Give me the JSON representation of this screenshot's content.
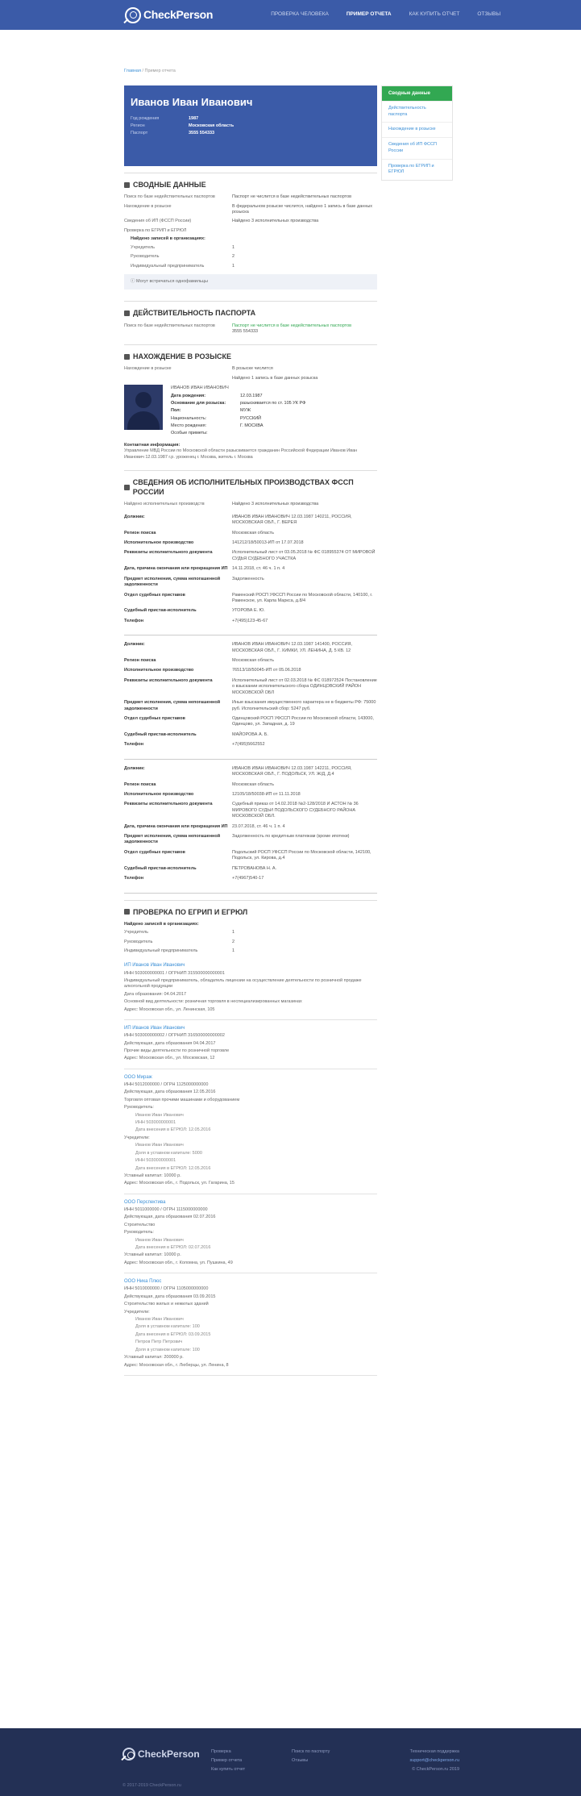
{
  "header": {
    "logo": "CheckPerson",
    "nav": [
      "ПРОВЕРКА ЧЕЛОВЕКА",
      "ПРИМЕР ОТЧЕТА",
      "КАК КУПИТЬ ОТЧЕТ",
      "ОТЗЫВЫ"
    ]
  },
  "breadcrumb": {
    "home": "Главная",
    "current": "/ Пример отчета"
  },
  "card": {
    "name": "Иванов Иван Иванович",
    "birth_k": "Год рождения",
    "birth_v": "1987",
    "region_k": "Регион",
    "region_v": "Московская область",
    "passport_k": "Паспорт",
    "passport_v": "3555 554333"
  },
  "sidebar": {
    "title": "Сводные данные",
    "items": [
      "Действительность паспорта",
      "Нахождение в розыске",
      "Сведения об ИП ФССП России",
      "Проверка по ЕГРИП и ЕГРЮЛ"
    ]
  },
  "s1": {
    "title": "Сводные данные",
    "r1k": "Поиск по базе недействительных паспортов",
    "r1v": "Паспорт не числится в базе недействительных паспортов",
    "r2k": "Нахождение в розыске",
    "r2v": "В федеральном розыске числится, найдено 1 запись в базе данных розыска",
    "r3k": "Сведения об ИП (ФССП России)",
    "r3v": "Найдено 3 исполнительных производства",
    "egr": "Проверка по ЕГРИП и ЕГРЮЛ",
    "found": "Найдено записей в организациях:",
    "f1k": "Учредитель",
    "f1v": "1",
    "f2k": "Руководитель",
    "f2v": "2",
    "f3k": "Индивидуальный предприниматель",
    "f3v": "1",
    "hint": "Могут встречаться однофамильцы"
  },
  "s2": {
    "title": "Действительность паспорта",
    "k": "Поиск по базе недействительных паспортов",
    "v": "Паспорт не числится в базе недействительных паспортов",
    "v2": "3555 554333"
  },
  "s3": {
    "title": "Нахождение в розыске",
    "k": "Нахождение в розыске",
    "v": "В розыске числится",
    "v2": "Найдено 1 запись в базе данных розыска",
    "pname": "ИВАНОВ ИВАН ИВАНОВИЧ",
    "d": [
      [
        "Дата рождения:",
        "12.03.1987"
      ],
      [
        "Основание для розыска:",
        "разыскивается по ст. 105 УК РФ"
      ],
      [
        "Пол:",
        "МУЖ"
      ],
      [
        "Национальность:",
        "РУССКИЙ"
      ],
      [
        "Место рождения:",
        "Г. МОСКВА"
      ],
      [
        "Особые приметы:",
        ""
      ]
    ],
    "contact_t": "Контактная информация:",
    "contact": "Управление МВД России по Московской области разыскивается гражданин Российской Федерации Иванов Иван Иванович 12.03.1987 г.р. уроженец г. Москва, житель г. Москва"
  },
  "s4": {
    "title": "Сведения об исполнительных производствах ФССП России",
    "k": "Найдено исполнительных производств",
    "v": "Найдено 3 исполнительных производства",
    "items": [
      [
        [
          "Должник:",
          "ИВАНОВ ИВАН ИВАНОВИЧ 12.03.1987 140211, РОССИЯ, МОСКОВСКАЯ ОБЛ., Г. ВЕРЕЯ"
        ],
        [
          "Регион поиска",
          "Московская область"
        ],
        [
          "Исполнительное производство",
          "141212/18/50013-ИП от 17.07.2018"
        ],
        [
          "Реквизиты исполнительного документа",
          "Исполнительный лист от 03.05.2018 № ФС 018955374 ОТ МИРОВОЙ СУДЬЯ СУДЕБНОГО УЧАСТКА"
        ],
        [
          "Дата, причина окончания или прекращения ИП",
          "14.11.2018, ст. 46 ч. 1 п. 4"
        ],
        [
          "Предмет исполнения, сумма непогашенной задолженности",
          "Задолженность"
        ],
        [
          "Отдел судебных приставов",
          "Раменский РОСП УФССП России по Московской области, 140100, г. Раменское, ул. Карла Маркса, д.8/4"
        ],
        [
          "Судебный пристав-исполнитель",
          "УГОРОВА Е. Ю."
        ],
        [
          "Телефон",
          "+7(495)123-45-67"
        ]
      ],
      [
        [
          "Должник:",
          "ИВАНОВ ИВАН ИВАНОВИЧ 12.03.1987 141400, РОССИЯ, МОСКОВСКАЯ ОБЛ., Г. ХИМКИ, УЛ. ЛЕНИНА, Д. 5 КВ. 12"
        ],
        [
          "Регион поиска",
          "Московская область"
        ],
        [
          "Исполнительное производство",
          "76513/18/50045-ИП от 05.06.2018"
        ],
        [
          "Реквизиты исполнительного документа",
          "Исполнительный лист от 02.03.2018 № ФС 018972524 Постановление о взыскании исполнительского сбора ОДИНЦОВСКИЙ РАЙОН МОСКОВСКОЙ ОБЛ"
        ],
        [
          "Предмет исполнения, сумма непогашенной задолженности",
          "Иные взыскания имущественного характера не в бюджеты РФ: 75000 руб. Исполнительский сбор: 5247 руб."
        ],
        [
          "Отдел судебных приставов",
          "Одинцовский РОСП УФССП России по Московской области, 143000, Одинцово, ул. Западная, д. 19"
        ],
        [
          "Судебный пристав-исполнитель",
          "МАЙОРОВА А. Б."
        ],
        [
          "Телефон",
          "+7(495)5662552"
        ]
      ],
      [
        [
          "Должник:",
          "ИВАНОВ ИВАН ИВАНОВИЧ 12.03.1987 142211, РОССИЯ, МОСКОВСКАЯ ОБЛ., Г. ПОДОЛЬСК, УЛ. Ж/Д, Д.4"
        ],
        [
          "Регион поиска",
          "Московская область"
        ],
        [
          "Исполнительное производство",
          "12105/18/50038-ИП от 11.11.2018"
        ],
        [
          "Реквизиты исполнительного документа",
          "Судебный приказ от 14.02.2018 №2-128/2018 И АСТОН № 36 МИРОВОГО СУДЬИ ПОДОЛЬСКОГО СУДЕБНОГО РАЙОНА МОСКОВСКОЙ ОБЛ."
        ],
        [
          "Дата, причина окончания или прекращения ИП",
          "23.07.2018, ст. 46 ч. 1 п. 4"
        ],
        [
          "Предмет исполнения, сумма непогашенной задолженности",
          "Задолженность по кредитным платежам (кроме ипотеки)"
        ],
        [
          "Отдел судебных приставов",
          "Подольский РОСП УФССП России по Московской области, 142100, Подольск, ул. Кирова, д.4"
        ],
        [
          "Судебный пристав-исполнитель",
          "ПЕТРОВАНОВА Н. А."
        ],
        [
          "Телефон",
          "+7(4967)540-17"
        ]
      ]
    ]
  },
  "s5": {
    "title": "Проверка по ЕГРИП и ЕГРЮЛ",
    "found": "Найдено записей в организациях:",
    "f": [
      [
        "Учредитель",
        "1"
      ],
      [
        "Руководитель",
        "2"
      ],
      [
        "Индивидуальный предприниматель",
        "1"
      ]
    ],
    "orgs": [
      {
        "t": "ИП Иванов Иван Иванович",
        "l": [
          "ИНН 503000000001 / ОГРНИП 315500000000001",
          "Индивидуальный предприниматель, обладатель лицензии на осуществление деятельности по розничной продаже алкогольной продукции",
          "Дата образования: 04.04.2017",
          "Основной вид деятельности: розничная торговля в неспециализированных магазинах",
          "Адрес: Московская обл., ул. Ленинская, 105"
        ]
      },
      {
        "t": "ИП Иванов Иван Иванович",
        "l": [
          "ИНН 503000000002 / ОГРНИП 316500000000002",
          "Действующая, дата образования 04.04.2017",
          "Прочие виды деятельности по розничной торговле",
          "Адрес: Московская обл., ул. Московская, 12"
        ]
      },
      {
        "t": "ООО Мираж",
        "l": [
          "ИНН 5012000000 / ОГРН 1125000000000",
          "Действующая, дата образования 12.05.2016",
          "Торговля оптовая прочими машинами и оборудованием",
          "Руководитель:",
          "Иванов Иван Иванович",
          "ИНН 503000000001",
          "Дата внесения в ЕГРЮЛ: 12.05.2016",
          "Учредители:",
          "Иванов Иван Иванович",
          "Доля в уставном капитале: 5000",
          "ИНН 503000000001",
          "Дата внесения в ЕГРЮЛ: 12.05.2016",
          "Уставный капитал: 10000 р.",
          "Адрес: Московская обл., г. Подольск, ул. Гагарина, 15"
        ]
      },
      {
        "t": "ООО Перспектива",
        "l": [
          "ИНН 5011000000 / ОГРН 1115000000000",
          "Действующая, дата образования 02.07.2016",
          "Строительство",
          "Руководитель:",
          "Иванов Иван Иванович",
          "Дата внесения в ЕГРЮЛ: 02.07.2016",
          "Уставный капитал: 10000 р.",
          "Адрес: Московская обл., г. Коломна, ул. Пушкина, 49"
        ]
      },
      {
        "t": "ООО Ника Плюс",
        "l": [
          "ИНН 5010000000 / ОГРН 1105000000000",
          "Действующая, дата образования 03.09.2015",
          "Строительство жилых и нежилых зданий",
          "Учредители:",
          "Иванов Иван Иванович",
          "Доля в уставном капитале: 100",
          "Дата внесения в ЕГРЮЛ: 03.09.2015",
          "Петров Петр Петрович",
          "Доля в уставном капитале: 100",
          "Уставный капитал: 200000 р.",
          "Адрес: Московская обл., г. Люберцы, ул. Ленина, 8"
        ]
      }
    ]
  },
  "footer": {
    "logo": "CheckPerson",
    "c1": [
      "Проверка",
      "Пример отчета",
      "Как купить отчет"
    ],
    "c2": [
      "Поиск по паспорту",
      "Отзывы"
    ],
    "c3": [
      "Техническая поддержка",
      "support@checkperson.ru",
      "© CheckPerson.ru 2019"
    ],
    "copy": "© 2017-2019 CheckPerson.ru"
  }
}
